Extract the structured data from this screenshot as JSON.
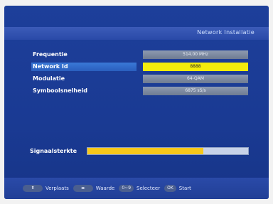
{
  "header": {
    "title": "Network Installatie"
  },
  "rows": [
    {
      "label": "Frequentie",
      "value": "514.00 MHz"
    },
    {
      "label": "Network Id",
      "value": "8888"
    },
    {
      "label": "Modulatie",
      "value": "64-QAM"
    },
    {
      "label": "Symboolsnelheid",
      "value": "6875 sS/s"
    }
  ],
  "signal": {
    "label": "Signaalsterkte",
    "level": 0.72,
    "fill_color": "#f7c81a"
  },
  "footer": {
    "move_key": "⬍",
    "move_label": "Verplaats",
    "value_key": "◂▸",
    "value_label": "Waarde",
    "select_key": "0~9",
    "select_label": "Selecteer",
    "ok_key": "OK",
    "start_label": "Start"
  },
  "colors": {
    "background": "#1a3a93",
    "selection": "#2a5fbe",
    "highlight": "#f3ec0c"
  }
}
